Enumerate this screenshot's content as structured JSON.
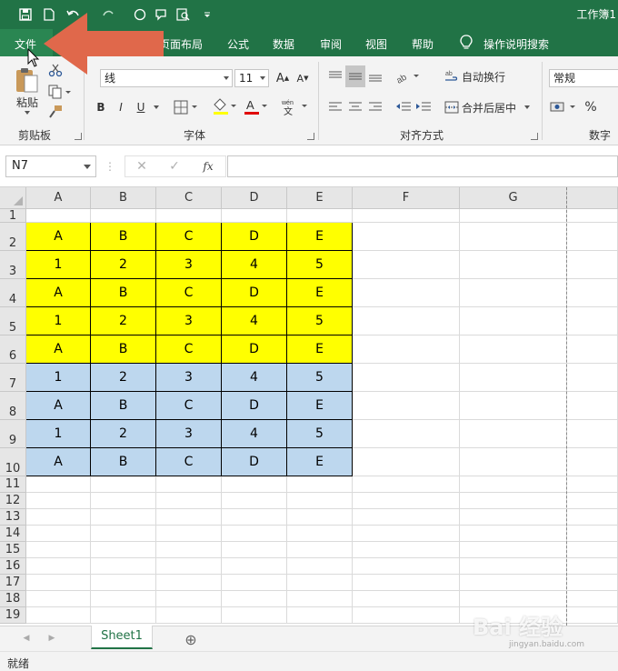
{
  "window": {
    "title": "工作簿1"
  },
  "ribbon_tabs": [
    {
      "label": "文件"
    },
    {
      "label": "页面布局"
    },
    {
      "label": "公式"
    },
    {
      "label": "数据"
    },
    {
      "label": "审阅"
    },
    {
      "label": "视图"
    },
    {
      "label": "帮助"
    },
    {
      "label": "操作说明搜索"
    }
  ],
  "clipboard": {
    "paste_label": "粘贴",
    "group_label": "剪贴板"
  },
  "font": {
    "font_name": "线",
    "font_size": "11",
    "group_label": "字体",
    "bold": "B",
    "italic": "I",
    "underline": "U"
  },
  "alignment": {
    "wrap_label": "自动换行",
    "merge_label": "合并后居中",
    "group_label": "对齐方式"
  },
  "number": {
    "format_value": "常规",
    "group_label": "数字",
    "percent": "%"
  },
  "formula_bar": {
    "name_box": "N7",
    "fx": "fx",
    "cancel": "✕",
    "enter": "✓"
  },
  "columns": [
    "A",
    "B",
    "C",
    "D",
    "E",
    "F",
    "G"
  ],
  "rows": [
    "1",
    "2",
    "3",
    "4",
    "5",
    "6",
    "7",
    "8",
    "9",
    "10",
    "11",
    "12",
    "13",
    "14",
    "15",
    "16",
    "17",
    "18",
    "19"
  ],
  "cells": [
    [
      "A",
      "B",
      "C",
      "D",
      "E"
    ],
    [
      "1",
      "2",
      "3",
      "4",
      "5"
    ],
    [
      "A",
      "B",
      "C",
      "D",
      "E"
    ],
    [
      "1",
      "2",
      "3",
      "4",
      "5"
    ],
    [
      "A",
      "B",
      "C",
      "D",
      "E"
    ],
    [
      "1",
      "2",
      "3",
      "4",
      "5"
    ],
    [
      "A",
      "B",
      "C",
      "D",
      "E"
    ],
    [
      "1",
      "2",
      "3",
      "4",
      "5"
    ],
    [
      "A",
      "B",
      "C",
      "D",
      "E"
    ]
  ],
  "sheet_tabs": [
    {
      "label": "Sheet1"
    }
  ],
  "add_sheet": "⊕",
  "status": {
    "text": "就绪"
  },
  "watermark": {
    "text": "Bai 经验",
    "sub": "jingyan.baidu.com"
  },
  "colors": {
    "accent": "#217346",
    "highlight_yellow": "#ffff00",
    "highlight_blue": "#bdd7ee",
    "arrow": "#e0684b"
  }
}
